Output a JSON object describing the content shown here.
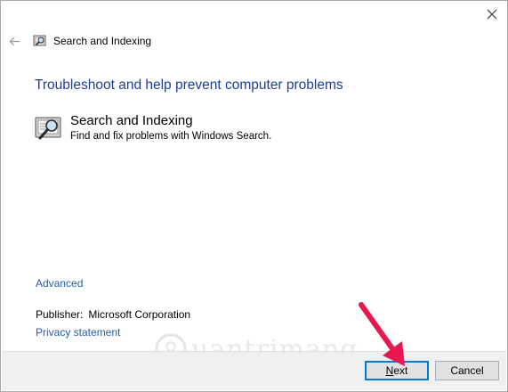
{
  "window": {
    "title": "Search and Indexing",
    "close_icon": "close-icon",
    "back_icon": "back-arrow-icon"
  },
  "main": {
    "heading": "Troubleshoot and help prevent computer problems",
    "task": {
      "title": "Search and Indexing",
      "description": "Find and fix problems with Windows Search.",
      "icon": "search-indexing-icon"
    },
    "advanced_link": "Advanced",
    "publisher_label": "Publisher:",
    "publisher_value": "Microsoft Corporation",
    "privacy_link": "Privacy statement"
  },
  "footer": {
    "next_label": "Next",
    "cancel_label": "Cancel"
  },
  "watermark": {
    "text": "uantrimang"
  },
  "colors": {
    "heading": "#1c3f95",
    "link": "#1f5fa8",
    "footer_bg": "#f0f0f0",
    "button_focus": "#0078d7",
    "annotation_arrow": "#e8174e"
  }
}
